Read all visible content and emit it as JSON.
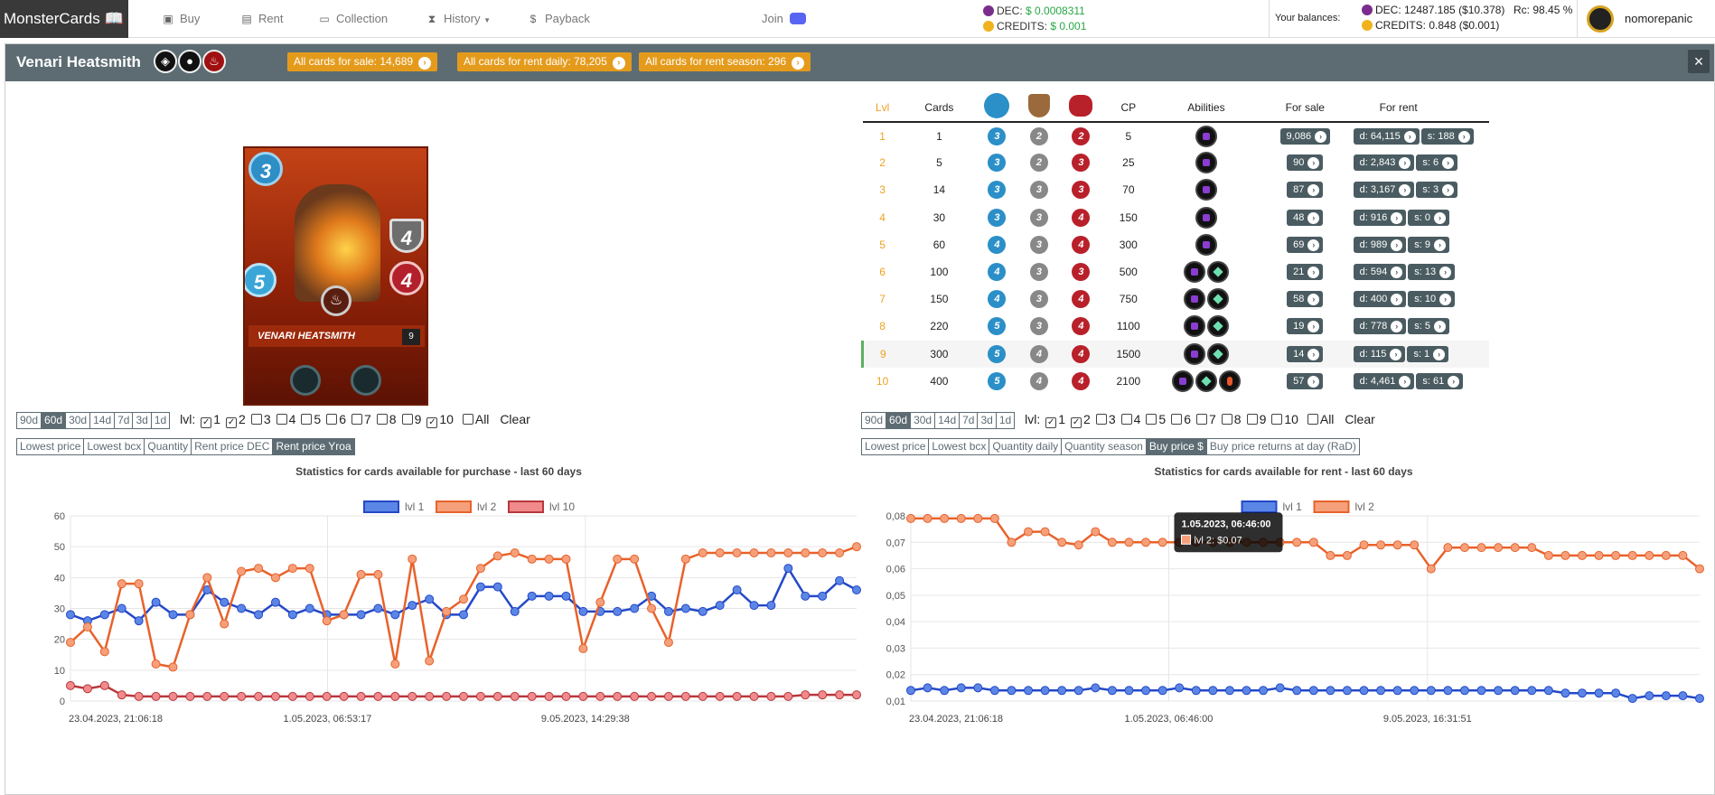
{
  "nav": {
    "brand": "MonsterCards",
    "items": [
      "Buy",
      "Rent",
      "Collection",
      "History",
      "Payback"
    ],
    "join": "Join"
  },
  "rates": {
    "dec_label": "DEC:",
    "dec_value": "$ 0.0008311",
    "credits_label": "CREDITS:",
    "credits_value": "$ 0.001"
  },
  "balances": {
    "label": "Your balances:",
    "dec": "DEC: 12487.185 ($10.378)",
    "credits": "CREDITS: 0.848 ($0.001)",
    "rc": "Rc: 98.45 %",
    "username": "nomorepanic"
  },
  "panel": {
    "title": "Venari Heatsmith",
    "btn_sale": "All cards for sale: 14,689",
    "btn_rent_daily": "All cards for rent daily: 78,205",
    "btn_rent_season": "All cards for rent season: 296",
    "close": "×"
  },
  "card": {
    "name": "VENARI HEATSMITH",
    "mana": "3",
    "speed": "5",
    "armor": "4",
    "health": "4",
    "level": "9"
  },
  "table": {
    "headers": {
      "lvl": "Lvl",
      "cards": "Cards",
      "cp": "CP",
      "abilities": "Abilities",
      "sale": "For sale",
      "rent": "For rent"
    },
    "rows": [
      {
        "lvl": "1",
        "cards": "1",
        "sp": "3",
        "ar": "2",
        "hp": "2",
        "cp": "5",
        "ab": [
          "sh"
        ],
        "sale": "9,086",
        "d": "d: 64,115",
        "s": "s: 188"
      },
      {
        "lvl": "2",
        "cards": "5",
        "sp": "3",
        "ar": "2",
        "hp": "3",
        "cp": "25",
        "ab": [
          "sh"
        ],
        "sale": "90",
        "d": "d: 2,843",
        "s": "s: 6"
      },
      {
        "lvl": "3",
        "cards": "14",
        "sp": "3",
        "ar": "3",
        "hp": "3",
        "cp": "70",
        "ab": [
          "sh"
        ],
        "sale": "87",
        "d": "d: 3,167",
        "s": "s: 3"
      },
      {
        "lvl": "4",
        "cards": "30",
        "sp": "3",
        "ar": "3",
        "hp": "4",
        "cp": "150",
        "ab": [
          "sh"
        ],
        "sale": "48",
        "d": "d: 916",
        "s": "s: 0"
      },
      {
        "lvl": "5",
        "cards": "60",
        "sp": "4",
        "ar": "3",
        "hp": "4",
        "cp": "300",
        "ab": [
          "sh"
        ],
        "sale": "69",
        "d": "d: 989",
        "s": "s: 9"
      },
      {
        "lvl": "6",
        "cards": "100",
        "sp": "4",
        "ar": "3",
        "hp": "3",
        "cp": "500",
        "ab": [
          "sh",
          "fo"
        ],
        "sale": "21",
        "d": "d: 594",
        "s": "s: 13"
      },
      {
        "lvl": "7",
        "cards": "150",
        "sp": "4",
        "ar": "3",
        "hp": "4",
        "cp": "750",
        "ab": [
          "sh",
          "fo"
        ],
        "sale": "58",
        "d": "d: 400",
        "s": "s: 10"
      },
      {
        "lvl": "8",
        "cards": "220",
        "sp": "5",
        "ar": "3",
        "hp": "4",
        "cp": "1100",
        "ab": [
          "sh",
          "fo"
        ],
        "sale": "19",
        "d": "d: 778",
        "s": "s: 5"
      },
      {
        "lvl": "9",
        "cards": "300",
        "sp": "5",
        "ar": "4",
        "hp": "4",
        "cp": "1500",
        "ab": [
          "sh",
          "fo"
        ],
        "sale": "14",
        "d": "d: 115",
        "s": "s: 1"
      },
      {
        "lvl": "10",
        "cards": "400",
        "sp": "5",
        "ar": "4",
        "hp": "4",
        "cp": "2100",
        "ab": [
          "sh",
          "fo",
          "fi"
        ],
        "sale": "57",
        "d": "d: 4,461",
        "s": "s: 61"
      }
    ]
  },
  "left": {
    "periods": [
      "90d",
      "60d",
      "30d",
      "14d",
      "7d",
      "3d",
      "1d"
    ],
    "active_period": "60d",
    "lvl_label": "lvl:",
    "levels": [
      {
        "l": "1",
        "c": true
      },
      {
        "l": "2",
        "c": true
      },
      {
        "l": "3",
        "c": false
      },
      {
        "l": "4",
        "c": false
      },
      {
        "l": "5",
        "c": false
      },
      {
        "l": "6",
        "c": false
      },
      {
        "l": "7",
        "c": false
      },
      {
        "l": "8",
        "c": false
      },
      {
        "l": "9",
        "c": false
      },
      {
        "l": "10",
        "c": true
      }
    ],
    "all": "All",
    "clear": "Clear",
    "tabs": [
      "Lowest price",
      "Lowest bcx",
      "Quantity",
      "Rent price DEC",
      "Rent price Yroa"
    ],
    "active_tab": "Rent price Yroa"
  },
  "right": {
    "periods": [
      "90d",
      "60d",
      "30d",
      "14d",
      "7d",
      "3d",
      "1d"
    ],
    "active_period": "60d",
    "lvl_label": "lvl:",
    "levels": [
      {
        "l": "1",
        "c": true
      },
      {
        "l": "2",
        "c": true
      },
      {
        "l": "3",
        "c": false
      },
      {
        "l": "4",
        "c": false
      },
      {
        "l": "5",
        "c": false
      },
      {
        "l": "6",
        "c": false
      },
      {
        "l": "7",
        "c": false
      },
      {
        "l": "8",
        "c": false
      },
      {
        "l": "9",
        "c": false
      },
      {
        "l": "10",
        "c": false
      }
    ],
    "all": "All",
    "clear": "Clear",
    "tabs": [
      "Lowest price",
      "Lowest bcx",
      "Quantity daily",
      "Quantity season",
      "Buy price $",
      "Buy price returns at day (RaD)"
    ],
    "active_tab": "Buy price $"
  },
  "chart_data": [
    {
      "type": "line",
      "title": "Statistics for cards available for purchase - last 60 days",
      "ylim": [
        0,
        60
      ],
      "yticks": [
        0,
        10,
        20,
        30,
        40,
        50,
        60
      ],
      "xlabels": [
        "23.04.2023, 21:06:18",
        "1.05.2023, 06:53:17",
        "9.05.2023, 14:29:38"
      ],
      "series": [
        {
          "name": "lvl 1",
          "color": "#2448c8",
          "fill": "#5b86e5",
          "values": [
            28,
            26,
            28,
            30,
            26,
            32,
            28,
            28,
            36,
            32,
            30,
            28,
            32,
            28,
            30,
            28,
            28,
            28,
            30,
            28,
            31,
            33,
            28,
            28,
            37,
            37,
            29,
            34,
            34,
            34,
            29,
            29,
            29,
            30,
            34,
            29,
            30,
            29,
            31,
            36,
            31,
            31,
            43,
            34,
            34,
            39,
            36
          ]
        },
        {
          "name": "lvl 2",
          "color": "#e8622b",
          "fill": "#f5a07a",
          "values": [
            19,
            24,
            16,
            38,
            38,
            12,
            11,
            28,
            40,
            25,
            42,
            43,
            40,
            43,
            43,
            26,
            28,
            41,
            41,
            12,
            46,
            13,
            29,
            33,
            43,
            47,
            48,
            46,
            46,
            46,
            17,
            32,
            46,
            46,
            30,
            19,
            46,
            48,
            48,
            48,
            48,
            48,
            48,
            48,
            48,
            48,
            50
          ]
        },
        {
          "name": "lvl 10",
          "color": "#b8383c",
          "fill": "#f08a8c",
          "values": [
            5,
            4,
            5,
            2,
            1.5,
            1.5,
            1.5,
            1.5,
            1.5,
            1.5,
            1.5,
            1.5,
            1.5,
            1.5,
            1.5,
            1.5,
            1.5,
            1.5,
            1.5,
            1.5,
            1.5,
            1.5,
            1.5,
            1.5,
            1.5,
            1.5,
            1.5,
            1.5,
            1.5,
            1.5,
            1.5,
            1.5,
            1.5,
            1.5,
            1.5,
            1.5,
            1.5,
            1.5,
            1.5,
            1.5,
            1.5,
            1.5,
            1.5,
            2,
            2,
            2,
            2
          ]
        }
      ]
    },
    {
      "type": "line",
      "title": "Statistics for cards available for rent - last 60 days",
      "ylim": [
        0.01,
        0.08
      ],
      "yticks": [
        "0,01",
        "0,02",
        "0,03",
        "0,04",
        "0,05",
        "0,06",
        "0,07",
        "0,08"
      ],
      "xlabels": [
        "23.04.2023, 21:06:18",
        "1.05.2023, 06:46:00",
        "9.05.2023, 16:31:51"
      ],
      "tooltip": {
        "title": "1.05.2023, 06:46:00",
        "line": "lvl 2: $0.07"
      },
      "series": [
        {
          "name": "lvl 1",
          "color": "#2448c8",
          "fill": "#5b86e5",
          "values": [
            0.014,
            0.015,
            0.014,
            0.015,
            0.015,
            0.014,
            0.014,
            0.014,
            0.014,
            0.014,
            0.014,
            0.015,
            0.014,
            0.014,
            0.014,
            0.014,
            0.015,
            0.014,
            0.014,
            0.014,
            0.014,
            0.014,
            0.015,
            0.014,
            0.014,
            0.014,
            0.014,
            0.014,
            0.014,
            0.014,
            0.014,
            0.014,
            0.014,
            0.014,
            0.014,
            0.014,
            0.014,
            0.014,
            0.014,
            0.013,
            0.013,
            0.013,
            0.013,
            0.011,
            0.012,
            0.012,
            0.012,
            0.011
          ]
        },
        {
          "name": "lvl 2",
          "color": "#e8622b",
          "fill": "#f5a07a",
          "values": [
            0.079,
            0.079,
            0.079,
            0.079,
            0.079,
            0.079,
            0.07,
            0.074,
            0.074,
            0.07,
            0.069,
            0.074,
            0.07,
            0.07,
            0.07,
            0.07,
            0.07,
            0.07,
            0.07,
            0.07,
            0.07,
            0.07,
            0.07,
            0.07,
            0.07,
            0.065,
            0.065,
            0.069,
            0.069,
            0.069,
            0.069,
            0.06,
            0.068,
            0.068,
            0.068,
            0.068,
            0.068,
            0.068,
            0.065,
            0.065,
            0.065,
            0.065,
            0.065,
            0.065,
            0.065,
            0.065,
            0.065,
            0.06
          ]
        }
      ]
    }
  ]
}
